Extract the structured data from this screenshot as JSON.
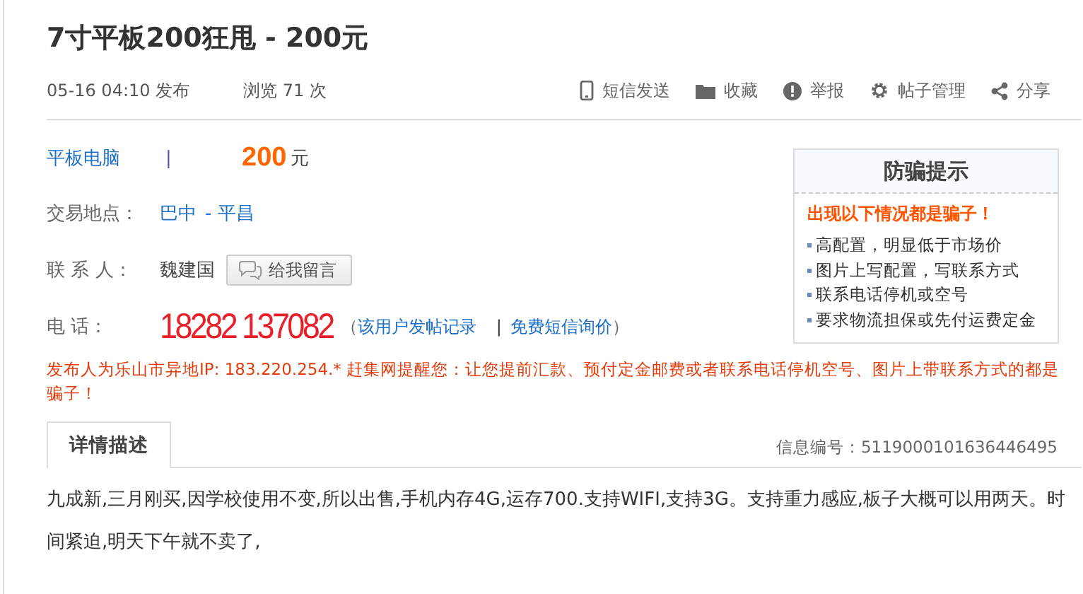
{
  "title": "7寸平板200狂甩  - 200元",
  "meta": {
    "posted": "05-16 04:10 发布",
    "views": "浏览  71 次"
  },
  "actions": [
    {
      "kind": "phone",
      "label": "短信发送"
    },
    {
      "kind": "folder",
      "label": "收藏"
    },
    {
      "kind": "alert",
      "label": "举报"
    },
    {
      "kind": "gear",
      "label": "帖子管理"
    },
    {
      "kind": "share",
      "label": "分享"
    }
  ],
  "category": "平板电脑",
  "separator": "|",
  "price": "200",
  "price_unit": "元",
  "location": {
    "label": "交易地点：",
    "city": "巴中",
    "district": "- 平昌"
  },
  "contact": {
    "label": "联 系 人：",
    "name": "魏建国",
    "message_button": "给我留言"
  },
  "phone": {
    "label": "电      话：",
    "number": "18282 137082",
    "open_paren": "（",
    "history_link": "该用户发帖记录",
    "divider": "|",
    "sms_link": "免费短信询价",
    "close_paren": "）"
  },
  "warning": "发布人为乐山市异地IP: 183.220.254.* 赶集网提醒您：让您提前汇款、预付定金邮费或者联系电话停机空号、图片上带联系方式的都是骗子！",
  "fraud_box": {
    "title": "防骗提示",
    "headline": "出现以下情况都是骗子！",
    "items": [
      "高配置，明显低于市场价",
      "图片上写配置，写联系方式",
      "联系电话停机或空号",
      "要求物流担保或先付运费定金"
    ]
  },
  "tabs": [
    {
      "label": "详情描述",
      "selected": true
    }
  ],
  "info_id": "信息编号：5119000101636446495",
  "description": "九成新,三月刚买,因学校使用不变,所以出售,手机内存4G,运存700.支持WIFI,支持3G。支持重力感应,板子大概可以用两天。时间紧迫,明天下午就不卖了,"
}
